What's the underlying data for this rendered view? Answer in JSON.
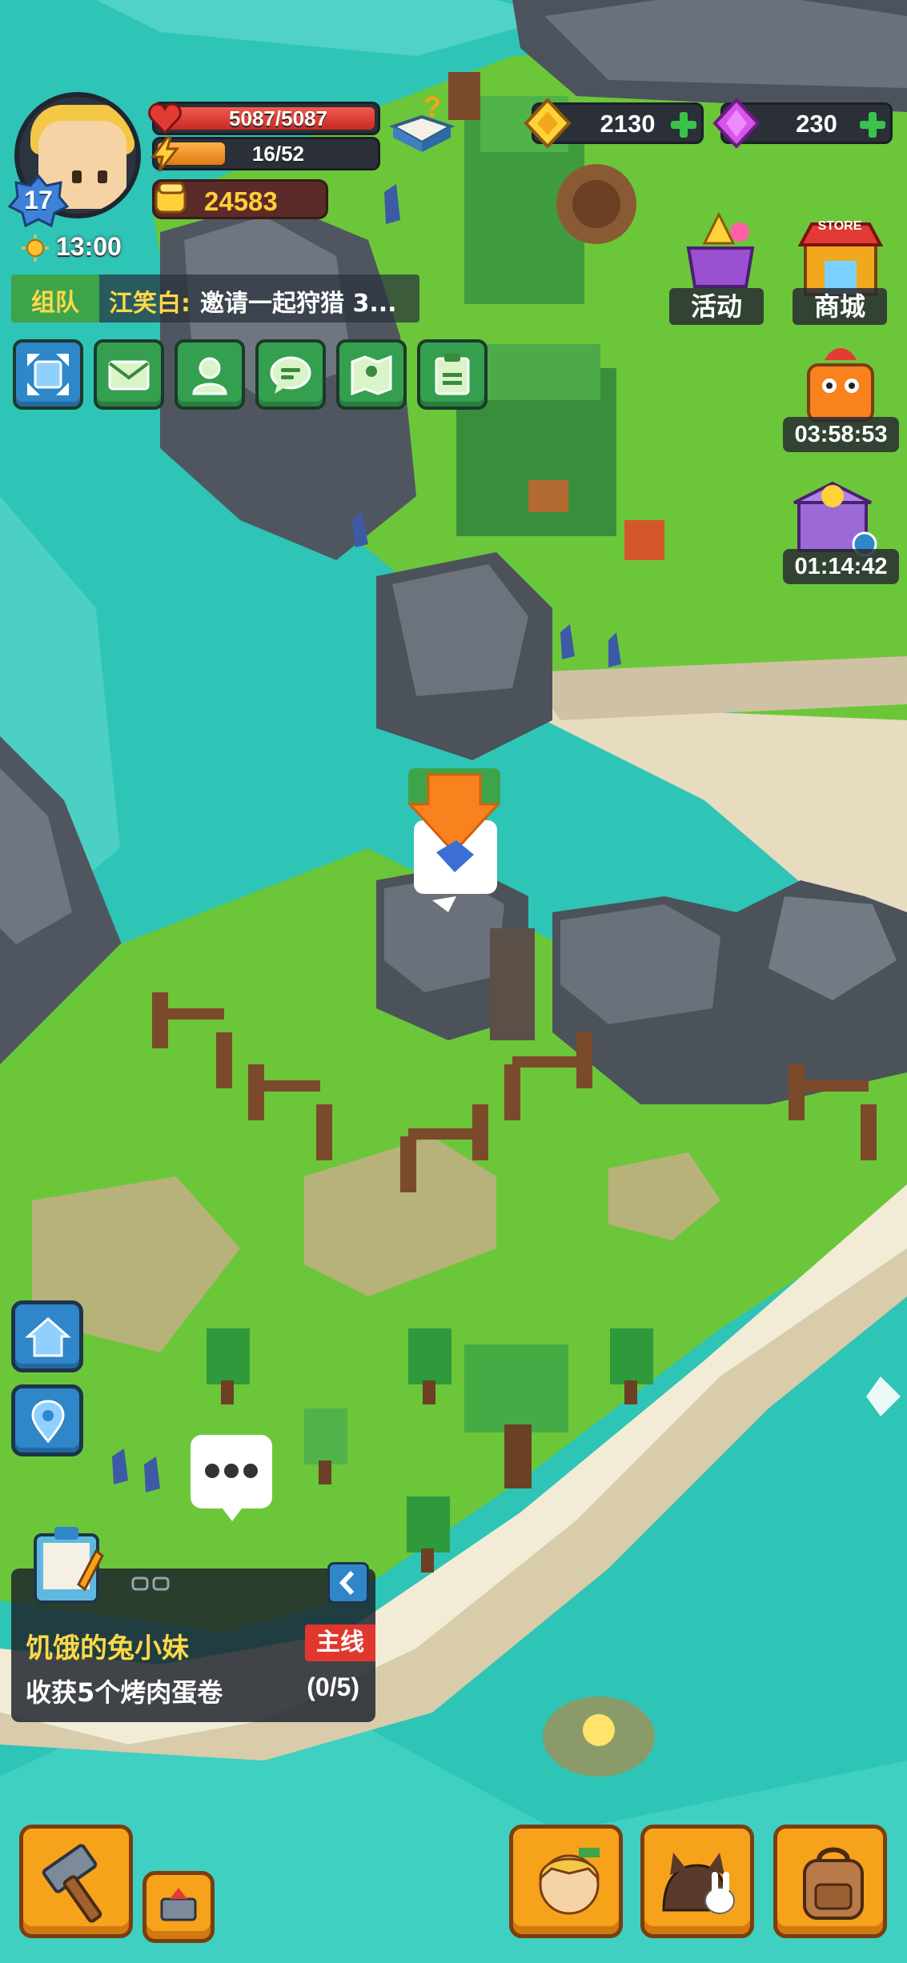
{
  "player": {
    "level": "17",
    "hp": "5087/5087",
    "hp_fraction": 1.0,
    "energy": "16/52",
    "energy_fraction": 0.31,
    "power": "24583",
    "time": "13:00"
  },
  "currency": {
    "gold": "2130",
    "gems": "230"
  },
  "chat": {
    "channel": "组队",
    "sender": "江笑白:",
    "message": "邀请一起狩猎 3..."
  },
  "top_right": {
    "events_label": "活动",
    "store_label": "商城",
    "store_sign": "STORE",
    "timer_1": "03:58:53",
    "timer_2": "01:14:42"
  },
  "quest": {
    "title": "饥饿的兔小妹",
    "badge": "主线",
    "task": "收获5个烤肉蛋卷",
    "progress": "(0/5)"
  },
  "colors": {
    "sea": "#2ec4b6",
    "grass": "#6cc63a",
    "sand": "#efe6cf",
    "rock": "#5c6370",
    "hp": "#e23b35",
    "energy": "#f39a21",
    "accent_green": "#3ea44a",
    "accent_blue": "#2f86c8",
    "accent_orange": "#f7a21b"
  }
}
